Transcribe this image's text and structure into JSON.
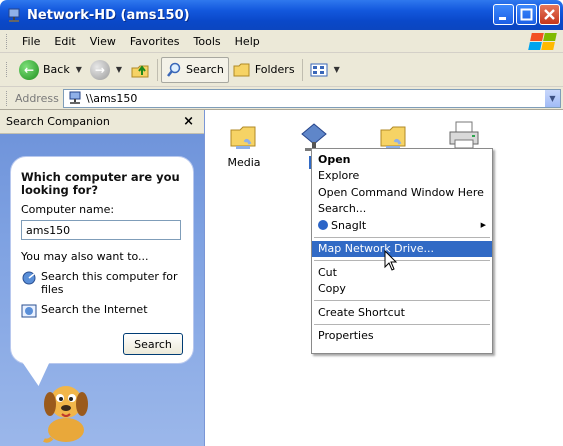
{
  "window": {
    "title": "Network-HD (ams150)"
  },
  "menubar": {
    "items": [
      "File",
      "Edit",
      "View",
      "Favorites",
      "Tools",
      "Help"
    ]
  },
  "toolbar": {
    "back_label": "Back",
    "search_label": "Search",
    "folders_label": "Folders"
  },
  "address": {
    "label": "Address",
    "value": "\\\\ams150"
  },
  "pane": {
    "title": "Search Companion",
    "question": "Which computer are you looking for?",
    "name_label": "Computer name:",
    "name_value": "ams150",
    "also_label": "You may also want to...",
    "options": [
      "Search this computer for files",
      "Search the Internet"
    ],
    "search_button": "Search"
  },
  "shares": [
    {
      "label": "Media",
      "icon": "shared-folder-icon"
    },
    {
      "label": "S",
      "icon": "network-share-icon",
      "selected": true
    },
    {
      "label": "",
      "icon": "shared-folder-icon"
    },
    {
      "label": "",
      "icon": "printer-icon"
    }
  ],
  "context_menu": {
    "items": [
      {
        "label": "Open",
        "bold": true
      },
      {
        "label": "Explore"
      },
      {
        "label": "Open Command Window Here"
      },
      {
        "label": "Search..."
      },
      {
        "label": "SnagIt",
        "submenu": true
      },
      {
        "label": "Map Network Drive...",
        "highlighted": true
      },
      {
        "label": "Cut"
      },
      {
        "label": "Copy"
      },
      {
        "label": "Create Shortcut"
      },
      {
        "label": "Properties"
      }
    ]
  },
  "colors": {
    "titlebar": "#0a48c9",
    "selection": "#316ac5",
    "pane_bg": "#7fa2e2",
    "chrome": "#ece9d8"
  }
}
